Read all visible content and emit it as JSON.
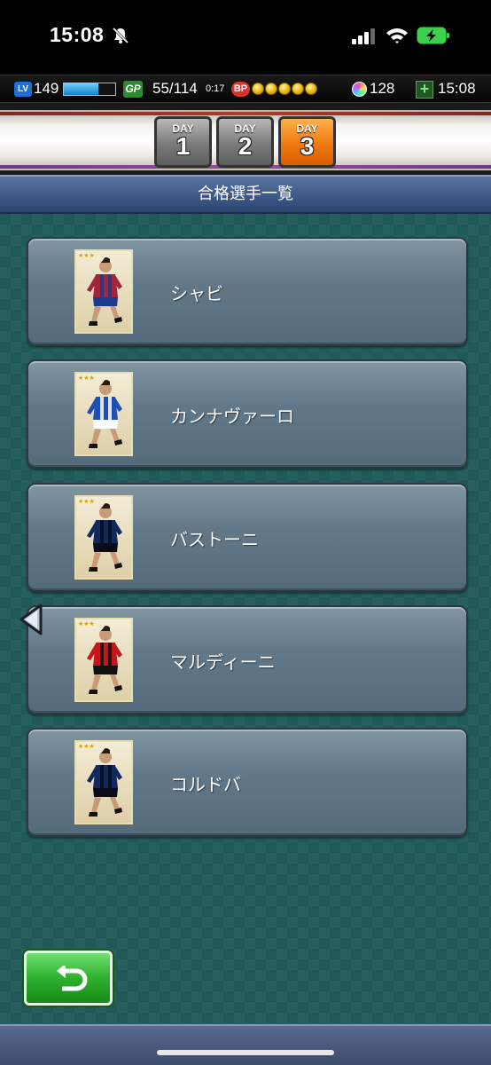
{
  "status_bar": {
    "time": "15:08",
    "icons": [
      "bell-slash-icon",
      "cellular-signal-icon",
      "wifi-icon",
      "battery-charging-icon"
    ]
  },
  "game_header": {
    "level_badge": "LV",
    "level": "149",
    "level_progress": 0.68,
    "gp_badge": "GP",
    "gp": "55/114",
    "gp_timer": "0:17",
    "bp_badge": "BP",
    "bp_coins": 5,
    "gems": "128",
    "clock": "15:08"
  },
  "day_tabs": [
    {
      "label": "DAY",
      "number": "1",
      "active": false
    },
    {
      "label": "DAY",
      "number": "2",
      "active": false
    },
    {
      "label": "DAY",
      "number": "3",
      "active": true
    }
  ],
  "title": "合格選手一覧",
  "players": [
    {
      "name": "シャビ",
      "kit": "barcelona",
      "colors": [
        "#a3243a",
        "#1b3c8c"
      ]
    },
    {
      "name": "カンナヴァーロ",
      "kit": "italy",
      "colors": [
        "#1f4fb0",
        "#ffffff"
      ]
    },
    {
      "name": "バストーニ",
      "kit": "inter",
      "colors": [
        "#12295e",
        "#0a0a1a"
      ]
    },
    {
      "name": "マルディーニ",
      "kit": "milan",
      "colors": [
        "#c0181c",
        "#111111"
      ]
    },
    {
      "name": "コルドバ",
      "kit": "inter",
      "colors": [
        "#12295e",
        "#0a0a1a"
      ]
    }
  ],
  "back_button": {
    "icon": "return-arrow-icon"
  }
}
